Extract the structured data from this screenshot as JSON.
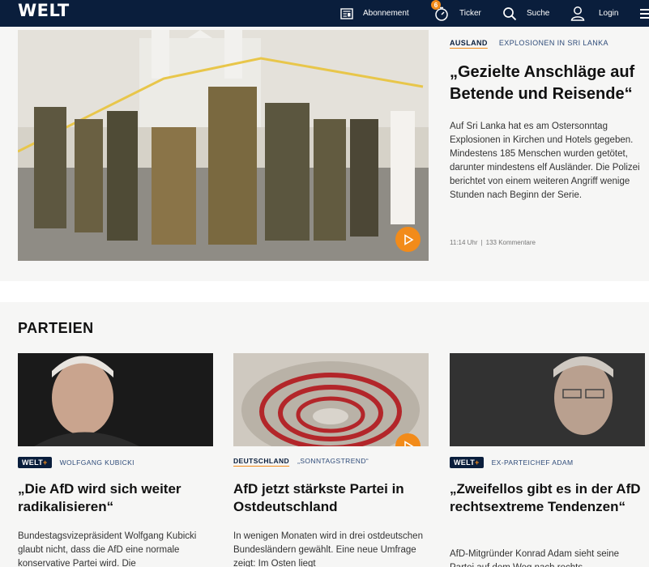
{
  "header": {
    "logo": "WELT",
    "nav": [
      {
        "label": "Abonnement",
        "icon": "newspaper-icon"
      },
      {
        "label": "Ticker",
        "icon": "stopwatch-icon",
        "badge": "6"
      },
      {
        "label": "Suche",
        "icon": "search-icon"
      },
      {
        "label": "Login",
        "icon": "user-icon"
      }
    ]
  },
  "lead": {
    "section": "AUSLAND",
    "topic": "EXPLOSIONEN IN SRI LANKA",
    "headline": "„Gezielte Anschläge auf Betende und Reisende“",
    "teaser": "Auf Sri Lanka hat es am Ostersonntag Explosionen in Kirchen und Hotels gegeben. Mindestens 185 Menschen wurden getötet, darunter mindestens elf Ausländer. Die Polizei berichtet von einem weiteren Angriff wenige Stunden nach Beginn der Serie.",
    "time": "11:14 Uhr",
    "comments": "133 Kommentare"
  },
  "section": {
    "title": "PARTEIEN",
    "cards": [
      {
        "badge": "WELT+",
        "kicker": "WOLFGANG KUBICKI",
        "title": "„Die AfD wird sich weiter radikalisieren“",
        "text": "Bundestagsvizepräsident Wolfgang Kubicki glaubt nicht, dass die AfD eine normale konservative Partei wird. Die"
      },
      {
        "section": "DEUTSCHLAND",
        "kicker": "„SONNTAGSTREND“",
        "title": "AfD jetzt stärkste Partei in Ostdeutschland",
        "text": "In wenigen Monaten wird in drei ostdeutschen Bundesländern gewählt. Eine neue Umfrage zeigt: Im Osten liegt"
      },
      {
        "badge": "WELT+",
        "kicker": "EX-PARTEICHEF ADAM",
        "title": "„Zweifellos gibt es in der AfD rechtsextreme Tendenzen“",
        "text": "AfD-Mitgründer Konrad Adam sieht seine Partei auf dem Weg nach rechts."
      }
    ]
  },
  "colors": {
    "navy": "#0a1e3c",
    "accent": "#f28b1a"
  }
}
